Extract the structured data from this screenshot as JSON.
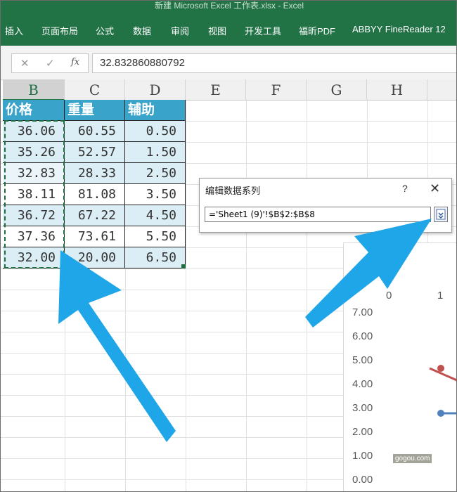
{
  "window": {
    "title": "新建 Microsoft Excel 工作表.xlsx - Excel"
  },
  "ribbon": {
    "tabs": [
      "插入",
      "页面布局",
      "公式",
      "数据",
      "审阅",
      "视图",
      "开发工具",
      "福昕PDF",
      "ABBYY FineReader 12"
    ]
  },
  "formula_bar": {
    "cancel_glyph": "✕",
    "confirm_glyph": "✓",
    "fx_label": "fx",
    "value": "32.832860880792"
  },
  "sheet": {
    "columns": [
      "B",
      "C",
      "D",
      "E",
      "F",
      "G",
      "H"
    ],
    "selected_column": "B",
    "headers": [
      "价格",
      "重量",
      "辅助"
    ],
    "rows": [
      [
        "36.06",
        "60.55",
        "0.50"
      ],
      [
        "35.26",
        "52.57",
        "1.50"
      ],
      [
        "32.83",
        "28.33",
        "2.50"
      ],
      [
        "38.11",
        "81.08",
        "3.50"
      ],
      [
        "36.72",
        "67.22",
        "4.50"
      ],
      [
        "37.36",
        "73.61",
        "5.50"
      ],
      [
        "32.00",
        "20.00",
        "6.50"
      ]
    ]
  },
  "dialog": {
    "title": "编辑数据系列",
    "help": "?",
    "close": "✕",
    "series_values": "='Sheet1 (9)'!$B$2:$B$8",
    "collapse_icon": "collapse-dialog-icon"
  },
  "chart": {
    "x_ticks": [
      "0",
      "1"
    ],
    "y_ticks": [
      "7.00",
      "6.00",
      "5.00",
      "4.00",
      "3.00",
      "2.00",
      "1.00",
      "0.00"
    ],
    "series_colors": [
      "#c0504d",
      "#4f81bd"
    ],
    "watermark": "gogou.com"
  },
  "annotations": {
    "arrow_color": "#1fa6e8"
  }
}
